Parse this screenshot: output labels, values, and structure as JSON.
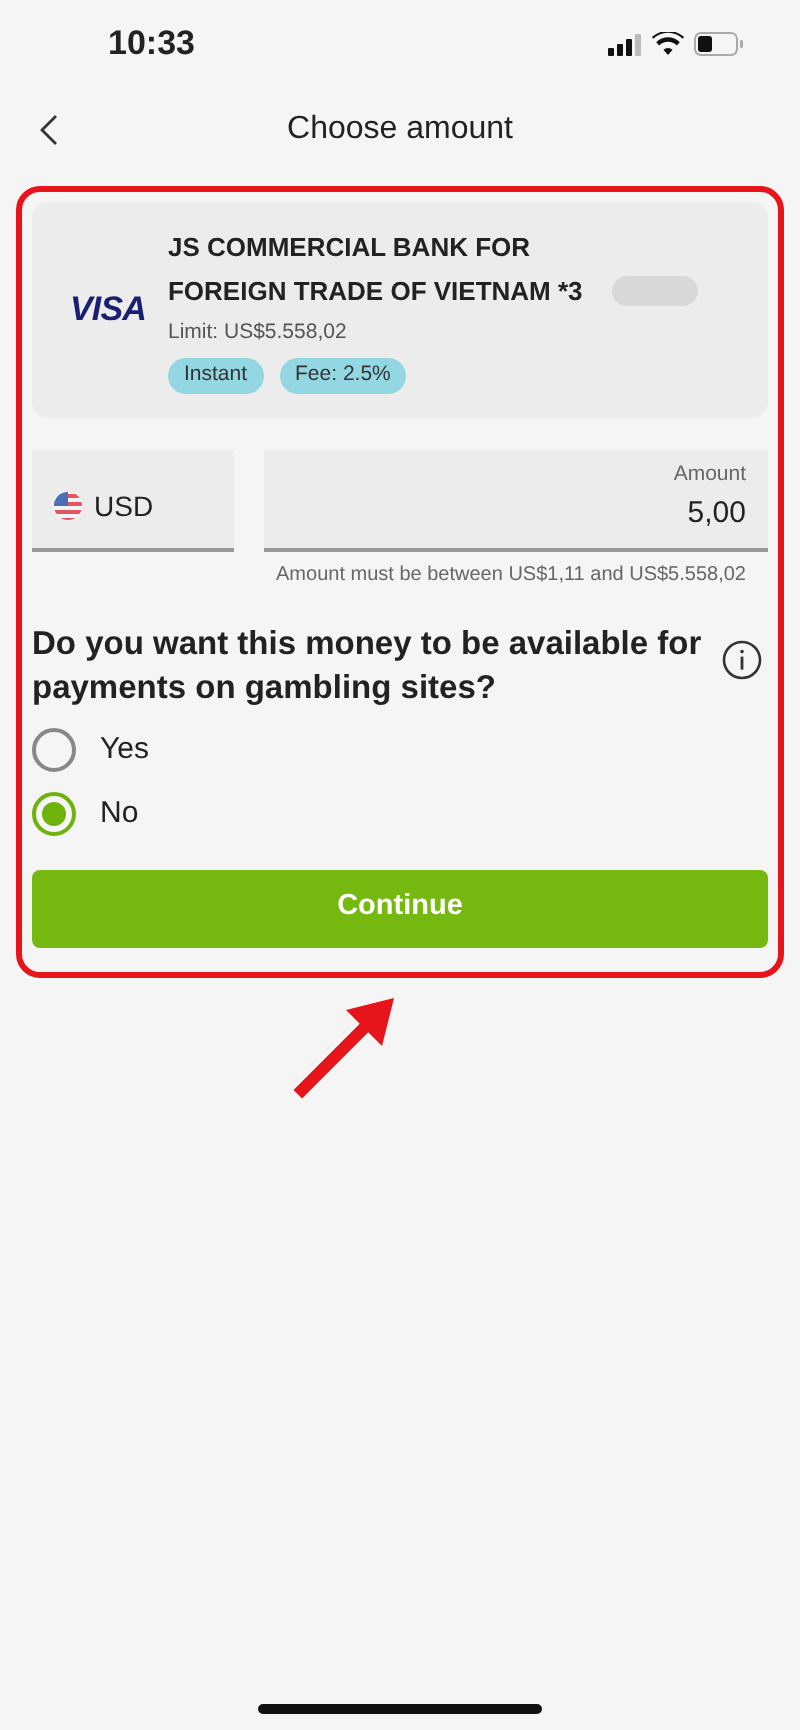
{
  "status_bar": {
    "time": "10:33"
  },
  "header": {
    "title": "Choose amount"
  },
  "card": {
    "brand": "VISA",
    "name": "JS COMMERCIAL BANK FOR FOREIGN TRADE OF VIETNAM *3",
    "limit": "Limit: US$5.558,02",
    "tags": [
      "Instant",
      "Fee: 2.5%"
    ]
  },
  "currency": {
    "code": "USD"
  },
  "amount": {
    "label": "Amount",
    "value": "5,00",
    "hint": "Amount must be between US$1,11 and US$5.558,02"
  },
  "question": "Do you want this money to be available for payments on gambling sites?",
  "options": [
    {
      "label": "Yes",
      "selected": false
    },
    {
      "label": "No",
      "selected": true
    }
  ],
  "button": "Continue"
}
